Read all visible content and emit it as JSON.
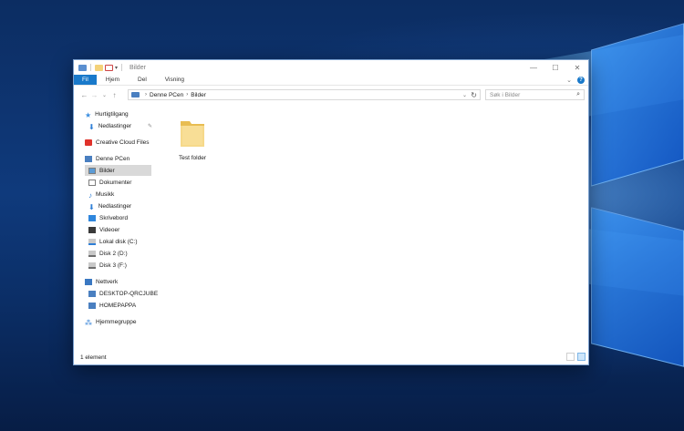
{
  "window": {
    "title": "Bilder",
    "controls": {
      "minimize": "—",
      "maximize": "☐",
      "close": "✕"
    }
  },
  "ribbon": {
    "tabs": [
      "Fil",
      "Hjem",
      "Del",
      "Visning"
    ],
    "expand_glyph": "⌄",
    "help": "?"
  },
  "nav": {
    "back": "←",
    "forward": "→",
    "recent": "⌄",
    "up": "↑",
    "breadcrumb": [
      "Denne PCen",
      "Bilder"
    ],
    "search_placeholder": "Søk i Bilder"
  },
  "sidebar": {
    "quick_access": "Hurtigtilgang",
    "quick_items": [
      "Nedlastinger"
    ],
    "creative_cloud": "Creative Cloud Files",
    "this_pc": "Denne PCen",
    "pc_items": [
      "Bilder",
      "Dokumenter",
      "Musikk",
      "Nedlastinger",
      "Skrivebord",
      "Videoer",
      "Lokal disk (C:)",
      "Disk 2 (D:)",
      "Disk 3 (F:)"
    ],
    "network": "Nettverk",
    "network_items": [
      "DESKTOP-QRCJUBE",
      "HOMEPAPPA"
    ],
    "homegroup": "Hjemmegruppe",
    "selected": "Bilder"
  },
  "content": {
    "items": [
      {
        "name": "Test folder",
        "type": "folder-icon"
      }
    ]
  },
  "status": {
    "count": "1 element"
  },
  "colors": {
    "accent": "#1979ca",
    "folder": "#f4d27a",
    "selected_bg": "#d9d9d9"
  }
}
